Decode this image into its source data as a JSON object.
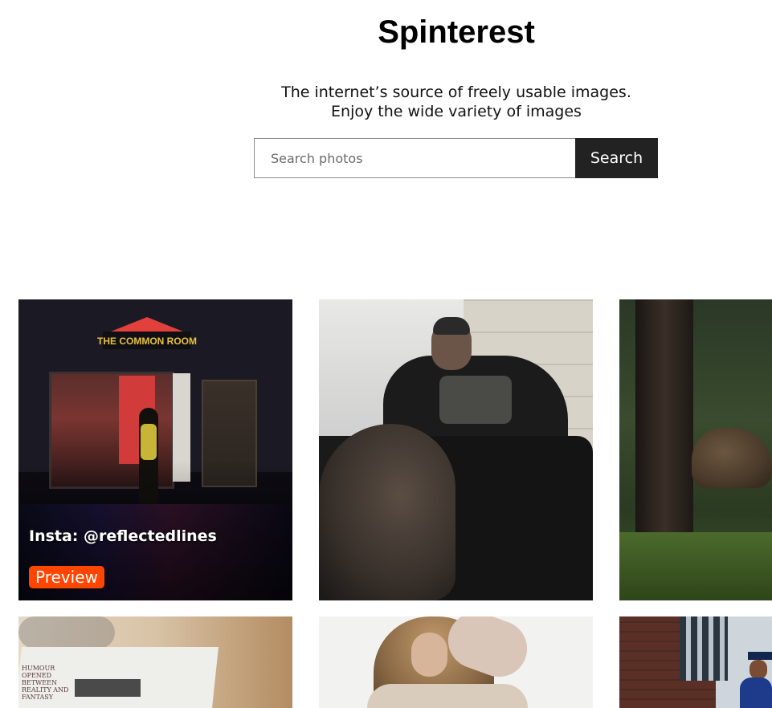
{
  "header": {
    "title": "Spinterest",
    "tagline_line1": "The internet’s source of freely usable images.",
    "tagline_line2": "Enjoy the wide variety of images"
  },
  "search": {
    "placeholder": "Search photos",
    "value": "",
    "button_label": "Search"
  },
  "gallery": {
    "cards": [
      {
        "credit": "Insta: @reflectedlines",
        "preview_label": "Preview",
        "sign_text": "THE COMMON ROOM"
      },
      {},
      {},
      {
        "headline": "HUMOUR OPENED BETWEEN REALITY AND FANTASY"
      },
      {},
      {}
    ]
  },
  "colors": {
    "accent_preview": "#ff4500",
    "search_button_bg": "#222222"
  }
}
